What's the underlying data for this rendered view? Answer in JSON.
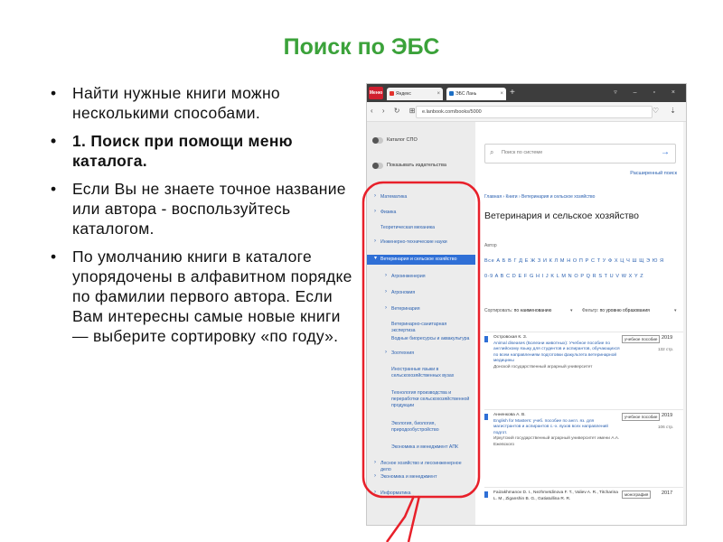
{
  "slide": {
    "title": "Поиск по ЭБС",
    "bullets": [
      {
        "text": "Найти нужные книги можно несколькими способами.",
        "bold": false
      },
      {
        "text": "1. Поиск при помощи меню каталога.",
        "bold": true
      },
      {
        "text": "Если Вы не знаете точное название или автора - воспользуйтесь каталогом.",
        "bold": false
      },
      {
        "text": "По умолчанию книги в каталоге упорядочены в алфавитном порядке по фамилии первого автора. Если Вам интересны самые новые книги — выберите сортировку «по году».",
        "bold": false
      }
    ]
  },
  "browser": {
    "opera_label": "Меню",
    "tabs": [
      {
        "label": "Яндекс"
      },
      {
        "label": "ЭБС Лань"
      }
    ],
    "url": "e.lanbook.com/books/5000"
  },
  "sidebar": {
    "catalog_toggle": "Каталог СПО",
    "publishers_toggle": "Показывать издательства",
    "categories": [
      {
        "label": "Математика",
        "level": 0,
        "arrow": true
      },
      {
        "label": "Физика",
        "level": 0,
        "arrow": true
      },
      {
        "label": "Теоретическая механика",
        "level": 0,
        "arrow": false
      },
      {
        "label": "Инженерно-технические науки",
        "level": 0,
        "arrow": true
      },
      {
        "label": "Ветеринария и сельское хозяйство",
        "level": 0,
        "arrow": true,
        "active": true
      },
      {
        "label": "Агроинженерия",
        "level": 1,
        "arrow": true
      },
      {
        "label": "Агрономия",
        "level": 1,
        "arrow": true
      },
      {
        "label": "Ветеринария",
        "level": 1,
        "arrow": true
      },
      {
        "label": "Ветеринарно-санитарная экспертиза",
        "level": 1,
        "arrow": false
      },
      {
        "label": "Водные биоресурсы и аквакультура",
        "level": 1,
        "arrow": false
      },
      {
        "label": "Зоотехния",
        "level": 1,
        "arrow": true
      },
      {
        "label": "Иностранные языки в сельскохозяйственных вузах",
        "level": 1,
        "arrow": false
      },
      {
        "label": "Технология производства и переработки сельскохозяйственной продукции",
        "level": 1,
        "arrow": false
      },
      {
        "label": "Экология, биология, природообустройство",
        "level": 1,
        "arrow": false
      },
      {
        "label": "Экономика и менеджмент АПК",
        "level": 1,
        "arrow": false
      },
      {
        "label": "Лесное хозяйство и лесоинженерное дело",
        "level": 0,
        "arrow": true
      },
      {
        "label": "Экономика и менеджмент",
        "level": 0,
        "arrow": true
      },
      {
        "label": "Информатика",
        "level": 0,
        "arrow": true
      }
    ]
  },
  "main": {
    "search_placeholder": "Поиск по системе",
    "advanced_search": "Расширенный поиск",
    "breadcrumbs": "Главная › Книги › Ветеринария и сельское хозяйство",
    "heading": "Ветеринария и сельское хозяйство",
    "author_label": "Автор",
    "alphabet_ru": "Все А Б В Г Д Е Ж З И К Л М Н О П Р С Т У Ф Х Ц Ч Ш Щ Э Ю Я",
    "alphabet_en": "0-9 A B C D E F G H I J K L M N O P Q R S T U V W X Y Z",
    "sort_label": "Сортировать:",
    "sort_value": "по наименованию",
    "filter_label": "Фильтр:",
    "filter_value": "по уровню образования",
    "books": [
      {
        "author": "Островская К. З.",
        "title": "Animal diseases (Болезни животных): Учебное пособие по английскому языку для студентов и аспирантов, обучающихся по всем направлениям подготовки факультета ветеринарной медицины",
        "publisher": "Донской государственный аграрный университет",
        "tag": "учебное пособие",
        "year": "2019",
        "pages": "132 стр."
      },
      {
        "author": "Анненкова А. В.",
        "title": "English for Masters: учеб. пособие по англ. яз. для магистрантов и аспирантов с.-х. вузов всех направлений подгот.",
        "publisher": "Иркутский государственный аграрный университет имени А.А. Ежевского",
        "tag": "учебное пособие",
        "year": "2019",
        "pages": "106 стр."
      },
      {
        "author": "Faizakhmanov D. I., Nezhmetdinova F. T., Valiev A. R., Titcharina L. M., Ziganshin B. G., Gatiatullina R. R.",
        "title": "",
        "publisher": "",
        "tag": "монография",
        "year": "2017",
        "pages": ""
      }
    ]
  },
  "colors": {
    "title_green": "#3ba23a",
    "accent_blue": "#2f6fd6",
    "callout_red": "#e8202a"
  }
}
